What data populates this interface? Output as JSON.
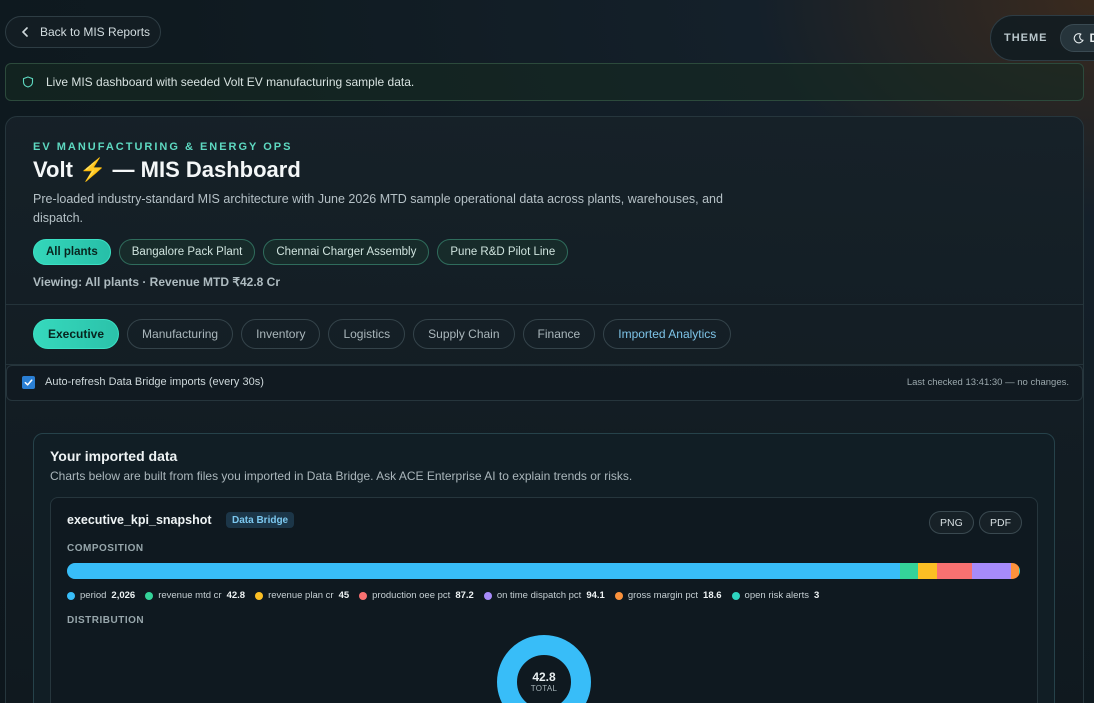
{
  "nav": {
    "back_label": "Back to MIS Reports"
  },
  "theme": {
    "label": "THEME",
    "value": "D"
  },
  "banner": {
    "text": "Live MIS dashboard with seeded Volt EV manufacturing sample data."
  },
  "header": {
    "eyebrow": "EV MANUFACTURING & ENERGY OPS",
    "title": "Volt ⚡ — MIS Dashboard",
    "subtitle": "Pre-loaded industry-standard MIS architecture with June 2026 MTD sample operational data across plants, warehouses, and dispatch.",
    "viewing": "Viewing: All plants · Revenue MTD ₹42.8 Cr"
  },
  "plants": [
    {
      "label": "All plants",
      "active": true
    },
    {
      "label": "Bangalore Pack Plant",
      "active": false
    },
    {
      "label": "Chennai Charger Assembly",
      "active": false
    },
    {
      "label": "Pune R&D Pilot Line",
      "active": false
    }
  ],
  "tabs": [
    {
      "label": "Executive",
      "active": true
    },
    {
      "label": "Manufacturing"
    },
    {
      "label": "Inventory"
    },
    {
      "label": "Logistics"
    },
    {
      "label": "Supply Chain"
    },
    {
      "label": "Finance"
    },
    {
      "label": "Imported Analytics"
    }
  ],
  "refresh": {
    "checked": true,
    "label": "Auto-refresh Data Bridge imports (every 30s)",
    "status": "Last checked 13:41:30 — no changes."
  },
  "imported": {
    "title": "Your imported data",
    "subtitle": "Charts below are built from files you imported in Data Bridge. Ask ACE Enterprise AI to explain trends or risks."
  },
  "kpi_card": {
    "title": "executive_kpi_snapshot",
    "badge": "Data Bridge",
    "png_label": "PNG",
    "pdf_label": "PDF",
    "composition_label": "COMPOSITION",
    "distribution_label": "DISTRIBUTION",
    "donut_value": "42.8",
    "donut_label": "TOTAL"
  },
  "colors": {
    "period": "#38bdf8",
    "revenue_mtd_cr": "#34d399",
    "revenue_plan_cr": "#fbbf24",
    "production_oee_pct": "#f87171",
    "on_time_dispatch_pct": "#a78bfa",
    "gross_margin_pct": "#fb923c",
    "open_risk_alerts": "#2dd4bf"
  },
  "chart_data": {
    "type": "bar",
    "title": "",
    "categories": [
      "period",
      "revenue mtd cr",
      "revenue plan cr",
      "production oee pct",
      "on time dispatch pct",
      "gross margin pct",
      "open risk alerts"
    ],
    "values": [
      2026,
      42.8,
      45,
      87.2,
      94.1,
      18.6,
      3
    ],
    "display_values": [
      "2,026",
      "42.8",
      "45",
      "87.2",
      "94.1",
      "18.6",
      "3"
    ],
    "colors": [
      "#38bdf8",
      "#34d399",
      "#fbbf24",
      "#f87171",
      "#a78bfa",
      "#fb923c",
      "#2dd4bf"
    ],
    "stacked": true,
    "orientation": "horizontal"
  }
}
